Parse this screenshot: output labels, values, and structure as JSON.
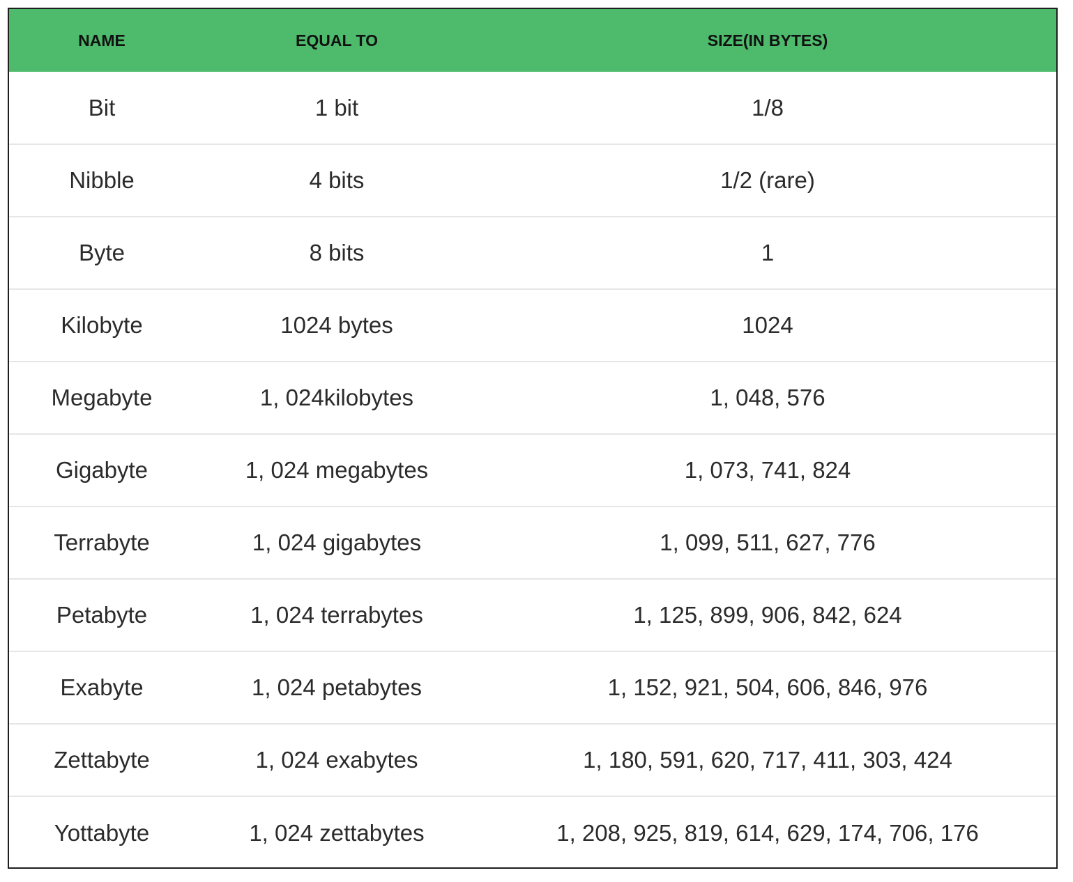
{
  "colors": {
    "header_background": "#4dba6c",
    "header_text": "#111111",
    "cell_text": "#2b2b2b",
    "row_divider": "#e6e6e6",
    "outer_border": "#1f1f1f"
  },
  "table": {
    "headers": [
      "NAME",
      "EQUAL TO",
      "SIZE(IN BYTES)"
    ],
    "rows": [
      [
        "Bit",
        "1 bit",
        "1/8"
      ],
      [
        "Nibble",
        "4 bits",
        "1/2 (rare)"
      ],
      [
        "Byte",
        "8 bits",
        "1"
      ],
      [
        "Kilobyte",
        "1024 bytes",
        "1024"
      ],
      [
        "Megabyte",
        "1, 024kilobytes",
        "1, 048, 576"
      ],
      [
        "Gigabyte",
        "1, 024 megabytes",
        "1, 073, 741, 824"
      ],
      [
        "Terrabyte",
        "1, 024 gigabytes",
        "1, 099, 511, 627, 776"
      ],
      [
        "Petabyte",
        "1, 024 terrabytes",
        "1, 125, 899, 906, 842, 624"
      ],
      [
        "Exabyte",
        "1, 024 petabytes",
        "1, 152, 921, 504, 606, 846, 976"
      ],
      [
        "Zettabyte",
        "1, 024 exabytes",
        "1, 180, 591, 620, 717, 411, 303, 424"
      ],
      [
        "Yottabyte",
        "1, 024 zettabytes",
        "1, 208, 925, 819, 614, 629, 174, 706, 176"
      ]
    ]
  }
}
